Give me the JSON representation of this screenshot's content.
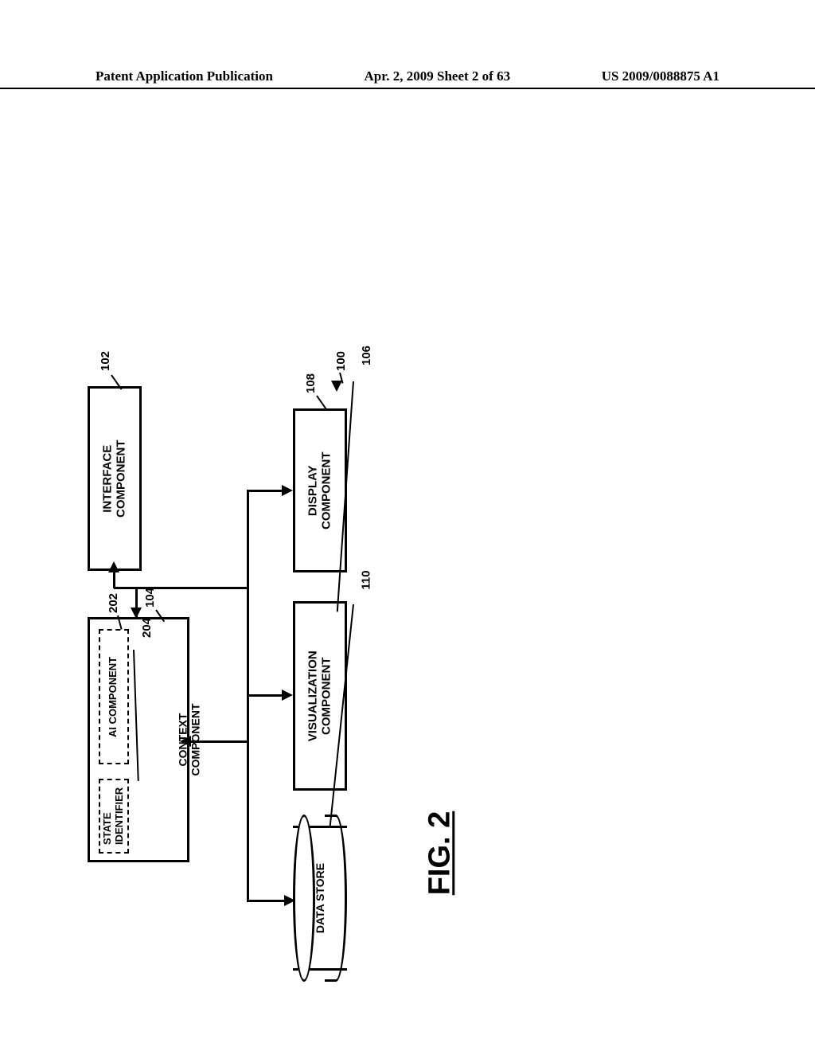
{
  "header": {
    "left": "Patent Application Publication",
    "mid": "Apr. 2, 2009  Sheet 2 of 63",
    "right": "US 2009/0088875 A1"
  },
  "figure_label": "FIG. 2",
  "refs": {
    "r100": "100",
    "r102": "102",
    "r104": "104",
    "r106": "106",
    "r108": "108",
    "r110": "110",
    "r202": "202",
    "r204": "204"
  },
  "boxes": {
    "interface": "INTERFACE\nCOMPONENT",
    "context": "CONTEXT\nCOMPONENT",
    "ai": "AI COMPONENT",
    "state": "STATE\nIDENTIFIER",
    "display": "DISPLAY\nCOMPONENT",
    "visualization": "VISUALIZATION\nCOMPONENT",
    "datastore": "DATA STORE"
  }
}
